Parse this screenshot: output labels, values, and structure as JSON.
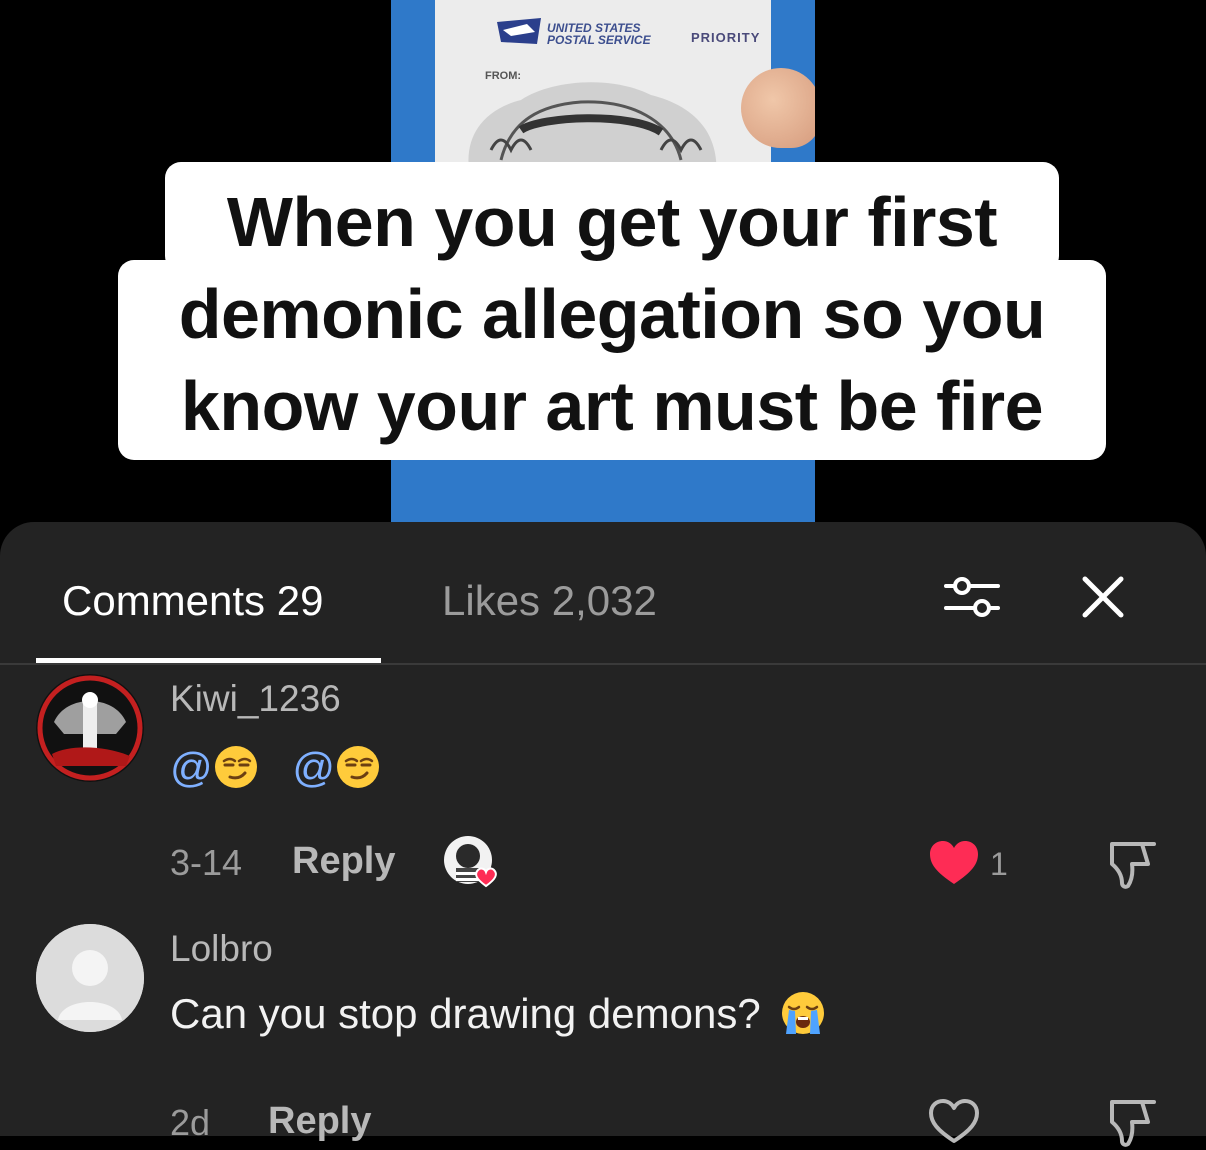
{
  "video": {
    "caption_lines": [
      "When you get your first",
      "demonic allegation so you",
      "know your art must be fire"
    ],
    "envelope": {
      "brand_text": "UNITED STATES POSTAL SERVICE",
      "priority_text": "PRIORITY",
      "from_label": "FROM:"
    }
  },
  "sheet": {
    "tabs": [
      {
        "label": "Comments 29",
        "active": true
      },
      {
        "label": "Likes 2,032",
        "active": false
      }
    ],
    "icons": {
      "filter": "sliders-icon",
      "close": "close-icon"
    }
  },
  "comments": [
    {
      "username": "Kiwi_1236",
      "text_parts": [
        "@",
        "@"
      ],
      "emoji": "smirking-face",
      "date": "3-14",
      "reply_label": "Reply",
      "creator_liked": true,
      "likes": "1",
      "liked": true
    },
    {
      "username": "Lolbro",
      "text": "Can you stop drawing demons?",
      "emoji": "loudly-crying-face",
      "date": "2d",
      "reply_label": "Reply",
      "creator_liked": false,
      "likes": "",
      "liked": false
    }
  ],
  "colors": {
    "sheet_bg": "#232323",
    "mention": "#7fb0ff",
    "like_red": "#fe2c55",
    "caption_bg": "#ffffff"
  }
}
